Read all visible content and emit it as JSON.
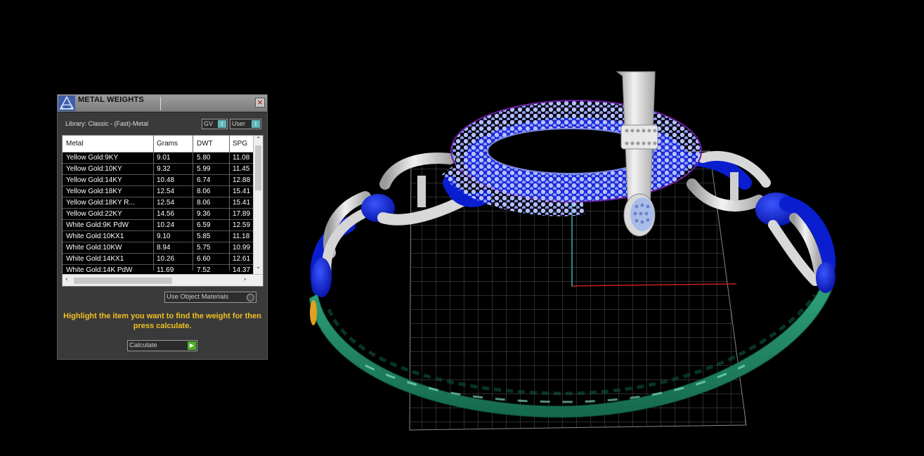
{
  "panel": {
    "title": "METAL WEIGHTS",
    "close": "×",
    "library_label": "Library: Classic - (Fast)-Metal",
    "toggle_gv": "GV",
    "toggle_user": "User",
    "toggle_indicator": "I",
    "columns": [
      "Metal",
      "Grams",
      "DWT",
      "SPG"
    ],
    "rows": [
      [
        "Yellow Gold:9KY",
        "9.01",
        "5.80",
        "11.08"
      ],
      [
        "Yellow Gold:10KY",
        "9.32",
        "5.99",
        "11.45"
      ],
      [
        "Yellow Gold:14KY",
        "10.48",
        "6.74",
        "12.88"
      ],
      [
        "Yellow Gold:18KY",
        "12.54",
        "8.06",
        "15.41"
      ],
      [
        "Yellow Gold:18KY R...",
        "12.54",
        "8.06",
        "15.41"
      ],
      [
        "Yellow Gold:22KY",
        "14.56",
        "9.36",
        "17.89"
      ],
      [
        "White Gold:9K PdW",
        "10.24",
        "6.59",
        "12.59"
      ],
      [
        "White Gold:10KX1",
        "9.10",
        "5.85",
        "11.18"
      ],
      [
        "White Gold:10KW",
        "8.94",
        "5.75",
        "10.99"
      ],
      [
        "White Gold:14KX1",
        "10.26",
        "6.60",
        "12.61"
      ],
      [
        "White Gold:14K PdW",
        "11.69",
        "7.52",
        "14.37"
      ]
    ],
    "use_object_materials": "Use Object Materials",
    "hint": "Highlight the item you want to find the weight for then press calculate.",
    "calculate": "Calculate"
  },
  "colors": {
    "band_green": "#1e7a5a",
    "link_blue": "#0a1ed0",
    "pave_lilac": "#9fb0f0",
    "prong_purple": "#6a1ea0",
    "metal_silver": "#d8d8d8",
    "grid": "#8a8a8a",
    "hint_yellow": "#f0c020"
  }
}
